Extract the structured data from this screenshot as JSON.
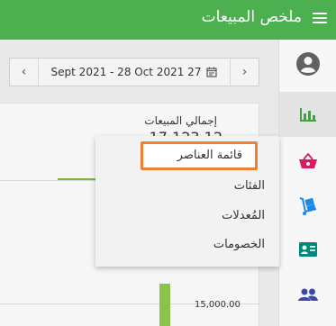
{
  "header": {
    "title": "ملخص المبيعات"
  },
  "toolbar": {
    "date_range": "Sept 2021 - 28 Oct 2021 27",
    "prev_symbol": "‹",
    "next_symbol": "›"
  },
  "card": {
    "label": "إجمالي المبيعات",
    "value": "17,123.12"
  },
  "chart": {
    "y_tick": "15,000.00"
  },
  "dropdown": {
    "items": [
      "قائمة العناصر",
      "الفئات",
      "المُعدلات",
      "الخصومات"
    ],
    "selected_index": 0
  },
  "colors": {
    "header": "#4caf50",
    "accent": "#f08030",
    "bar": "#8bc34a"
  }
}
